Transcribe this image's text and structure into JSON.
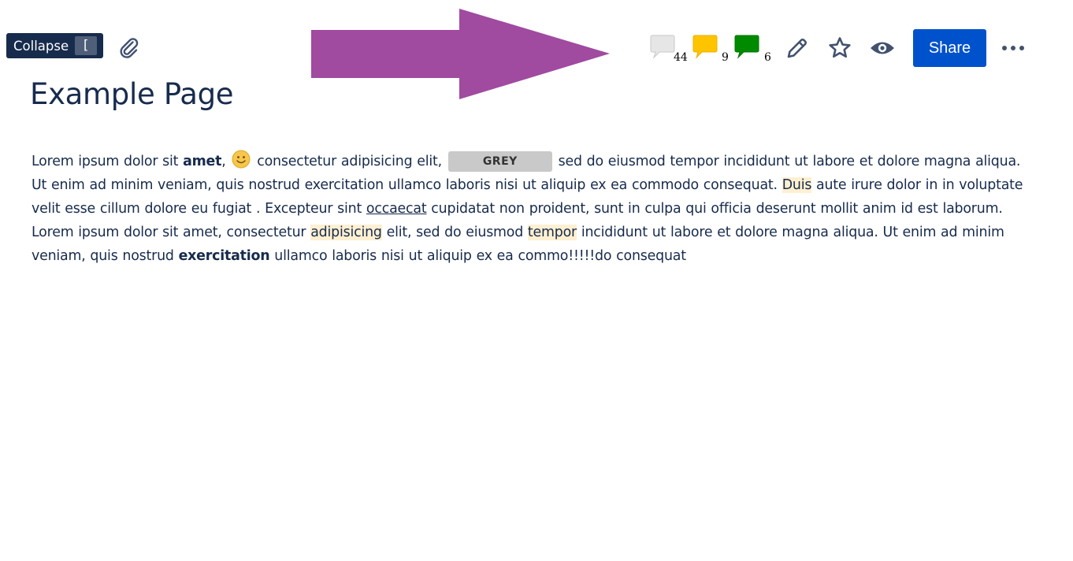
{
  "toolbar": {
    "collapse_label": "Collapse",
    "collapse_shortcut": "[",
    "comment_counts": {
      "grey": "44",
      "yellow": "9",
      "green": "6"
    },
    "share_label": "Share",
    "arrow_color": "#a04aa0",
    "share_color": "#0052cc"
  },
  "page": {
    "title": "Example Page",
    "body": {
      "p1": "Lorem ipsum dolor sit ",
      "b1": "amet",
      "p2": ",",
      "p3": " consectetur adipisicing elit, ",
      "status": "GREY",
      "p4": " sed do eiusmod tempor incididunt ut labore et dolore magna aliqua. Ut enim ad minim veniam, quis nostrud exercitation ullamco laboris nisi ut aliquip ex ea commodo consequat. ",
      "h1": "Duis",
      "p5": " aute irure dolor in  in voluptate velit esse cillum dolore eu fugiat . Excepteur sint ",
      "u1": "occaecat",
      "p6": " cupidatat non proident, sunt in culpa qui officia deserunt mollit anim id est laborum. Lorem ipsum dolor sit amet, consectetur ",
      "h2": "adipisicing",
      "p7": " elit, sed do eiusmod ",
      "h3": "tempor",
      "p8": " incididunt ut labore et dolore magna aliqua. Ut enim ad minim veniam, quis nostrud ",
      "b2": "exercitation",
      "p9": " ullamco laboris nisi ut aliquip ex ea commo!!!!!do consequat"
    }
  },
  "icons": {
    "attach": "paperclip-icon",
    "edit": "pencil-icon",
    "star": "star-icon",
    "watch": "eye-icon",
    "more": "more-dots-icon",
    "emoji": "smiley-icon"
  }
}
